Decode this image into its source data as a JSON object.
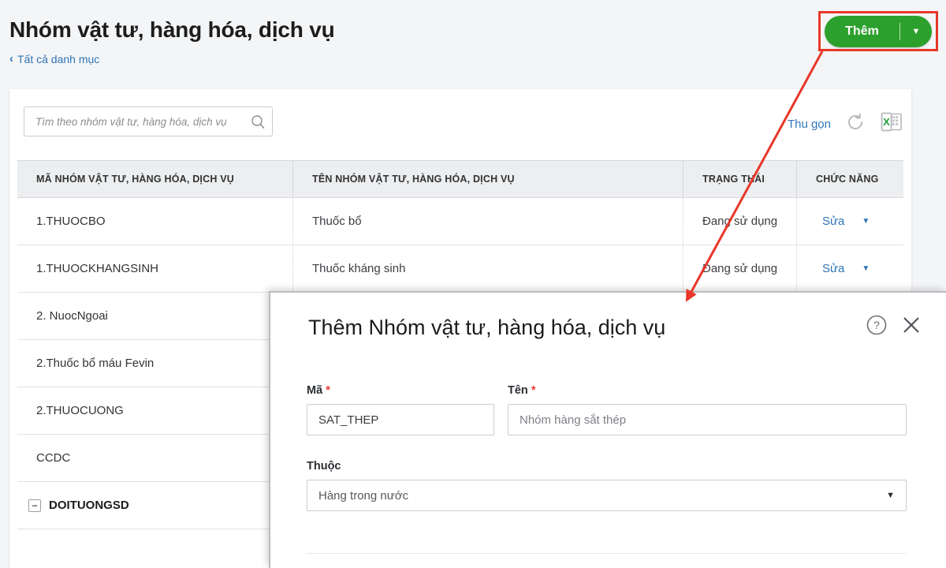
{
  "header": {
    "title": "Nhóm vật tư, hàng hóa, dịch vụ",
    "breadcrumb": "Tất cả danh mục",
    "breadcrumb_chevron": "‹",
    "add_button": {
      "label": "Thêm",
      "caret": "▼"
    }
  },
  "toolbar": {
    "search_placeholder": "Tìm theo nhóm vật tư, hàng hóa, dịch vụ",
    "search_value": "",
    "collapse_label": "Thu gọn",
    "icons": {
      "search": "search-icon",
      "refresh": "refresh-icon",
      "excel": "excel-export-icon"
    }
  },
  "table": {
    "columns": [
      "MÃ NHÓM VẬT TƯ, HÀNG HÓA, DỊCH VỤ",
      "TÊN NHÓM VẬT TƯ, HÀNG HÓA, DỊCH VỤ",
      "TRẠNG THÁI",
      "CHỨC NĂNG"
    ],
    "action_label": "Sửa",
    "action_caret": "▼",
    "expander_glyph": "−",
    "rows": [
      {
        "code": "1.THUOCBO",
        "name": "Thuốc bổ",
        "status": "Đang sử dụng",
        "action": "Sửa",
        "bold": false,
        "expandable": false
      },
      {
        "code": "1.THUOCKHANGSINH",
        "name": "Thuốc kháng sinh",
        "status": "Đang sử dụng",
        "action": "Sửa",
        "bold": false,
        "expandable": false
      },
      {
        "code": "2. NuocNgoai",
        "name": "",
        "status": "",
        "action": "",
        "bold": false,
        "expandable": false
      },
      {
        "code": "2.Thuốc bổ máu Fevin",
        "name": "",
        "status": "",
        "action": "",
        "bold": false,
        "expandable": false
      },
      {
        "code": "2.THUOCUONG",
        "name": "",
        "status": "",
        "action": "",
        "bold": false,
        "expandable": false
      },
      {
        "code": "CCDC",
        "name": "",
        "status": "",
        "action": "",
        "bold": false,
        "expandable": false
      },
      {
        "code": "DOITUONGSD",
        "name": "",
        "status": "",
        "action": "",
        "bold": true,
        "expandable": true
      }
    ]
  },
  "dialog": {
    "title": "Thêm Nhóm vật tư, hàng hóa, dịch vụ",
    "help_icon": "help-circle-icon",
    "close_icon": "close-icon",
    "fields": {
      "ma": {
        "label": "Mã",
        "required": "*",
        "value": "SAT_THEP",
        "placeholder": ""
      },
      "ten": {
        "label": "Tên",
        "required": "*",
        "value": "",
        "placeholder": "Nhóm hàng sắt thép"
      },
      "thuoc": {
        "label": "Thuộc",
        "value": "Hàng trong nước",
        "caret": "▼"
      }
    }
  },
  "annotation": {
    "color": "#e8372a",
    "highlight": "add-button-highlight-box",
    "arrow": "arrow-from-add-button-to-dialog"
  },
  "colors": {
    "accent_green": "#2ca02c",
    "link_blue": "#2e75b6",
    "annotation_red": "#e8372a",
    "page_bg": "#f4f5f7",
    "header_bg": "#eceef0"
  }
}
